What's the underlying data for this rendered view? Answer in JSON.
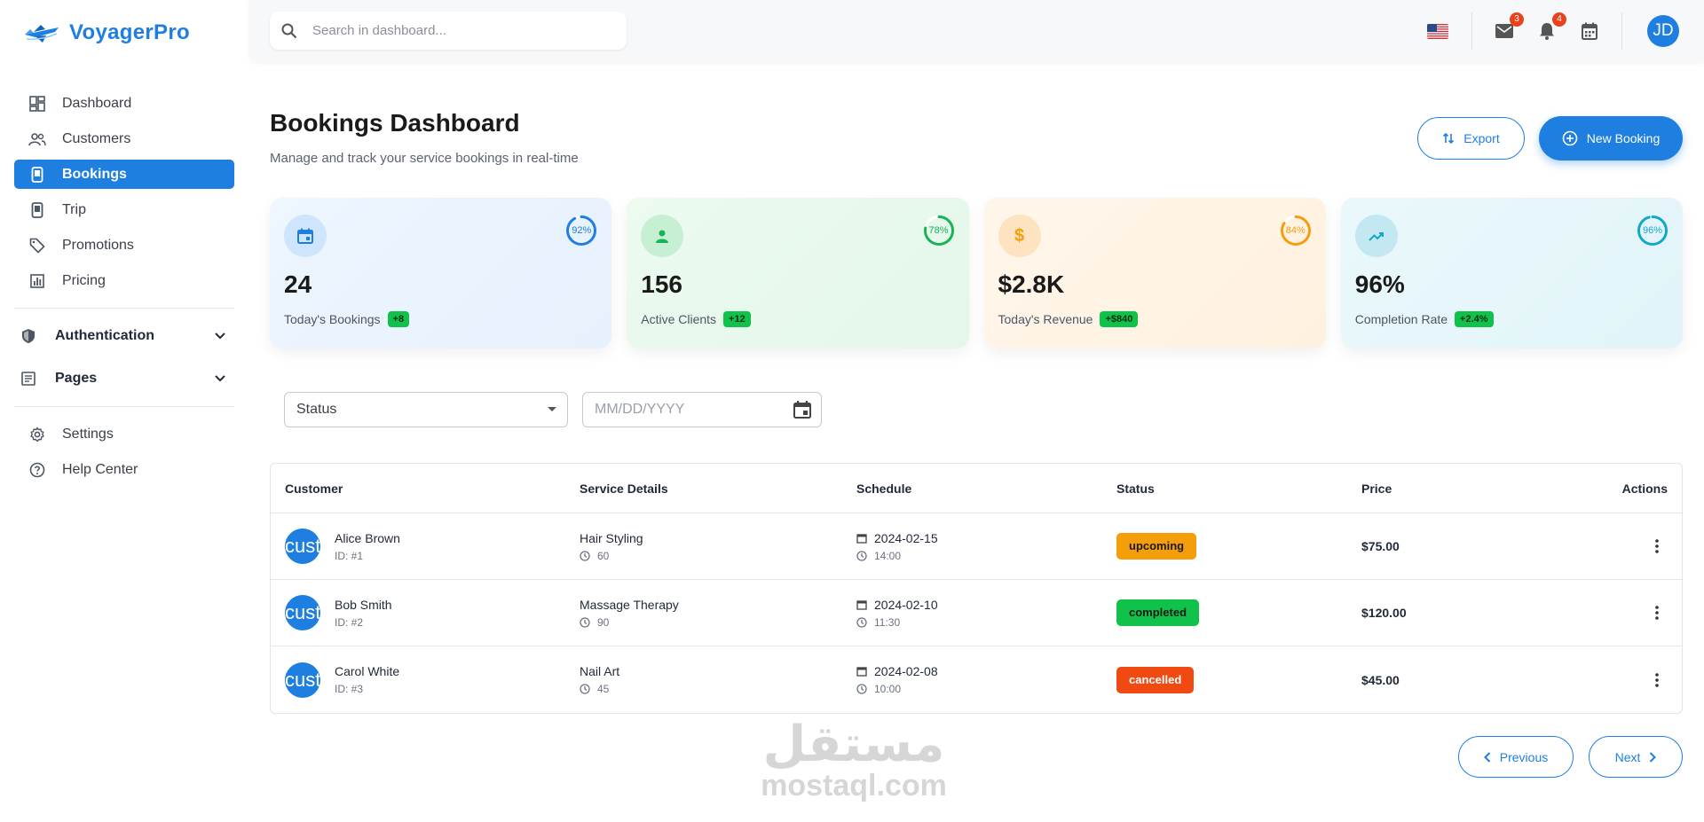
{
  "brand": {
    "name": "VoyagerPro"
  },
  "sidebar": {
    "items": [
      {
        "label": "Dashboard",
        "icon": "dashboard-icon"
      },
      {
        "label": "Customers",
        "icon": "people-icon"
      },
      {
        "label": "Bookings",
        "icon": "device-icon",
        "active": true
      },
      {
        "label": "Trip",
        "icon": "device-icon"
      },
      {
        "label": "Promotions",
        "icon": "tag-icon"
      },
      {
        "label": "Pricing",
        "icon": "bar-chart-icon"
      }
    ],
    "groups": [
      {
        "label": "Authentication",
        "icon": "shield-icon"
      },
      {
        "label": "Pages",
        "icon": "document-icon"
      }
    ],
    "footer_items": [
      {
        "label": "Settings",
        "icon": "gear-icon"
      },
      {
        "label": "Help Center",
        "icon": "help-icon"
      }
    ]
  },
  "topbar": {
    "search_placeholder": "Search in dashboard...",
    "mail_count": "3",
    "notification_count": "4",
    "avatar_initials": "JD"
  },
  "header": {
    "title": "Bookings Dashboard",
    "subtitle": "Manage and track your service bookings in real-time",
    "export_label": "Export",
    "new_booking_label": "New Booking"
  },
  "stats": [
    {
      "value": "24",
      "label": "Today's Bookings",
      "delta": "+8",
      "percent": "92%",
      "percent_value": 92,
      "accent": "#1e7fe0",
      "icon": "calendar-icon"
    },
    {
      "value": "156",
      "label": "Active Clients",
      "delta": "+12",
      "percent": "78%",
      "percent_value": 78,
      "accent": "#16b454",
      "icon": "person-icon"
    },
    {
      "value": "$2.8K",
      "label": "Today's Revenue",
      "delta": "+$840",
      "percent": "84%",
      "percent_value": 84,
      "accent": "#f59e0b",
      "icon": "dollar-icon"
    },
    {
      "value": "96%",
      "label": "Completion Rate",
      "delta": "+2.4%",
      "percent": "96%",
      "percent_value": 96,
      "accent": "#10a8c8",
      "icon": "trending-up-icon"
    }
  ],
  "filters": {
    "status_label": "Status",
    "date_placeholder": "MM/DD/YYYY"
  },
  "table": {
    "columns": [
      "Customer",
      "Service Details",
      "Schedule",
      "Status",
      "Price",
      "Actions"
    ],
    "rows": [
      {
        "avatar_text": "custo",
        "name": "Alice Brown",
        "id": "ID: #1",
        "service": "Hair Styling",
        "duration": "60",
        "date": "2024-02-15",
        "time": "14:00",
        "status": "upcoming",
        "status_color": "#f59e0b",
        "price": "$75.00"
      },
      {
        "avatar_text": "custo",
        "name": "Bob Smith",
        "id": "ID: #2",
        "service": "Massage Therapy",
        "duration": "90",
        "date": "2024-02-10",
        "time": "11:30",
        "status": "completed",
        "status_color": "#11c24a",
        "price": "$120.00"
      },
      {
        "avatar_text": "custo",
        "name": "Carol White",
        "id": "ID: #3",
        "service": "Nail Art",
        "duration": "45",
        "date": "2024-02-08",
        "time": "10:00",
        "status": "cancelled",
        "status_color": "#f04a12",
        "price": "$45.00"
      }
    ]
  },
  "pagination": {
    "previous_label": "Previous",
    "next_label": "Next"
  },
  "watermark": {
    "arabic": "مستقل",
    "latin": "mostaql.com"
  }
}
